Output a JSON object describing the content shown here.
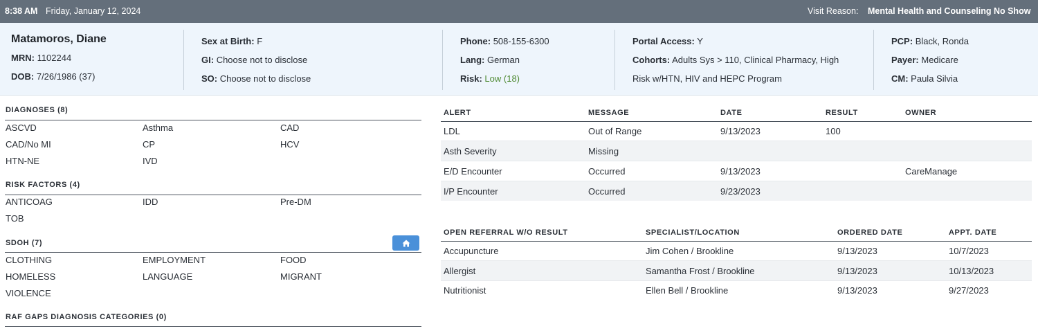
{
  "topbar": {
    "time": "8:38 AM",
    "date": "Friday, January 12, 2024",
    "visit_reason_label": "Visit Reason:",
    "visit_reason_value": "Mental Health and Counseling No Show"
  },
  "patient": {
    "name": "Matamoros, Diane",
    "mrn_label": "MRN:",
    "mrn": "1102244",
    "dob_label": "DOB:",
    "dob": "7/26/1986 (37)",
    "sex_label": "Sex at Birth:",
    "sex": "F",
    "gi_label": "GI:",
    "gi": "Choose not to disclose",
    "so_label": "SO:",
    "so": "Choose not to disclose",
    "phone_label": "Phone:",
    "phone": "508-155-6300",
    "lang_label": "Lang:",
    "lang": "German",
    "risk_label": "Risk:",
    "risk": "Low (18)",
    "portal_label": "Portal Access:",
    "portal": "Y",
    "cohorts_label": "Cohorts:",
    "cohorts_line1": "Adults Sys > 110, Clinical Pharmacy, High",
    "cohorts_line2": "Risk w/HTN, HIV and HEPC Program",
    "pcp_label": "PCP:",
    "pcp": "Black, Ronda",
    "payer_label": "Payer:",
    "payer": "Medicare",
    "cm_label": "CM:",
    "cm": "Paula Silvia"
  },
  "diagnoses": {
    "title": "DIAGNOSES (8)",
    "items": [
      "ASCVD",
      "Asthma",
      "CAD",
      "CAD/No MI",
      "CP",
      "HCV",
      "HTN-NE",
      "IVD"
    ]
  },
  "risk_factors": {
    "title": "RISK FACTORS (4)",
    "items": [
      "ANTICOAG",
      "IDD",
      "Pre-DM",
      "TOB"
    ]
  },
  "sdoh": {
    "title": "SDOH (7)",
    "items": [
      "CLOTHING",
      "EMPLOYMENT",
      "FOOD",
      "HOMELESS",
      "LANGUAGE",
      "MIGRANT",
      "VIOLENCE"
    ]
  },
  "raf": {
    "title": "RAF GAPS DIAGNOSIS CATEGORIES (0)"
  },
  "alerts": {
    "headers": [
      "ALERT",
      "MESSAGE",
      "DATE",
      "RESULT",
      "OWNER"
    ],
    "rows": [
      [
        "LDL",
        "Out of Range",
        "9/13/2023",
        "100",
        ""
      ],
      [
        "Asth Severity",
        "Missing",
        "",
        "",
        ""
      ],
      [
        "E/D Encounter",
        "Occurred",
        "9/13/2023",
        "",
        "CareManage"
      ],
      [
        "I/P Encounter",
        "Occurred",
        "9/23/2023",
        "",
        ""
      ]
    ]
  },
  "referrals": {
    "headers": [
      "OPEN REFERRAL W/O RESULT",
      "SPECIALIST/LOCATION",
      "ORDERED DATE",
      "APPT. DATE"
    ],
    "rows": [
      [
        "Accupuncture",
        "Jim Cohen / Brookline",
        "9/13/2023",
        "10/7/2023"
      ],
      [
        "Allergist",
        "Samantha Frost / Brookline",
        "9/13/2023",
        "10/13/2023"
      ],
      [
        "Nutritionist",
        "Ellen Bell / Brookline",
        "9/13/2023",
        "9/27/2023"
      ]
    ]
  },
  "icons": {
    "sdoh_button": "home-icon"
  },
  "colors": {
    "topbar": "#646f7b",
    "banner": "#eef5fc",
    "risk_low": "#4f8a33",
    "button": "#4a90d9"
  }
}
